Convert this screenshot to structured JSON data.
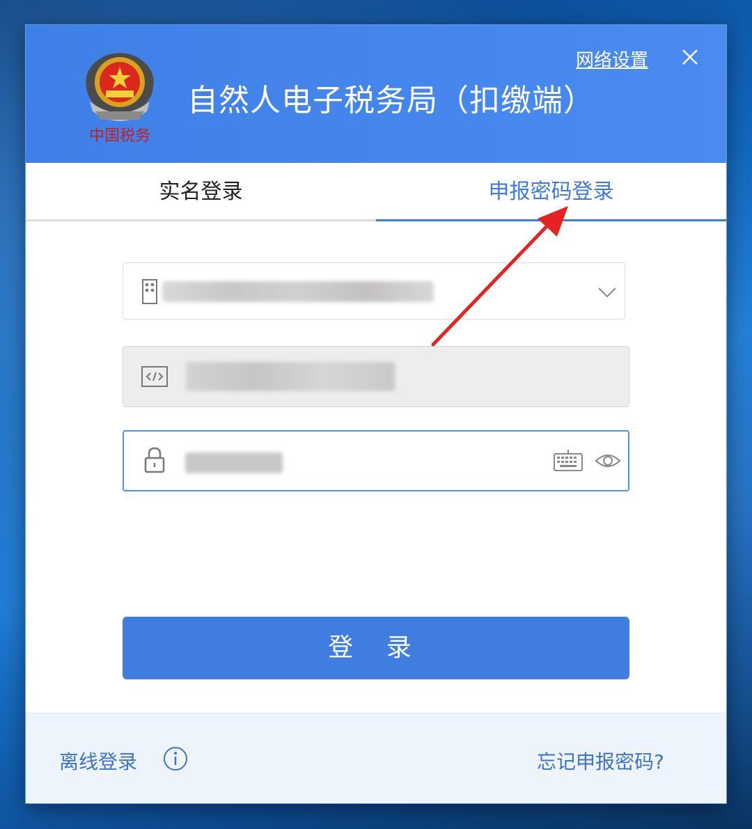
{
  "window": {
    "title": "自然人电子税务局（扣缴端）",
    "network_settings": "网络设置",
    "emblem_text": "中国税务"
  },
  "tabs": [
    {
      "label": "实名登录",
      "active": false
    },
    {
      "label": "申报密码登录",
      "active": true
    }
  ],
  "form": {
    "account": {
      "value": "",
      "masked": true
    },
    "taxpayer_code": {
      "value": "",
      "masked": true
    },
    "password": {
      "value": "",
      "masked": true
    }
  },
  "login_button": "登 录",
  "footer": {
    "offline_login": "离线登录",
    "forgot_password": "忘记申报密码?"
  },
  "colors": {
    "header_blue": "#4a8bf0",
    "accent_blue": "#3b7be0",
    "arrow_red": "#e52421"
  }
}
